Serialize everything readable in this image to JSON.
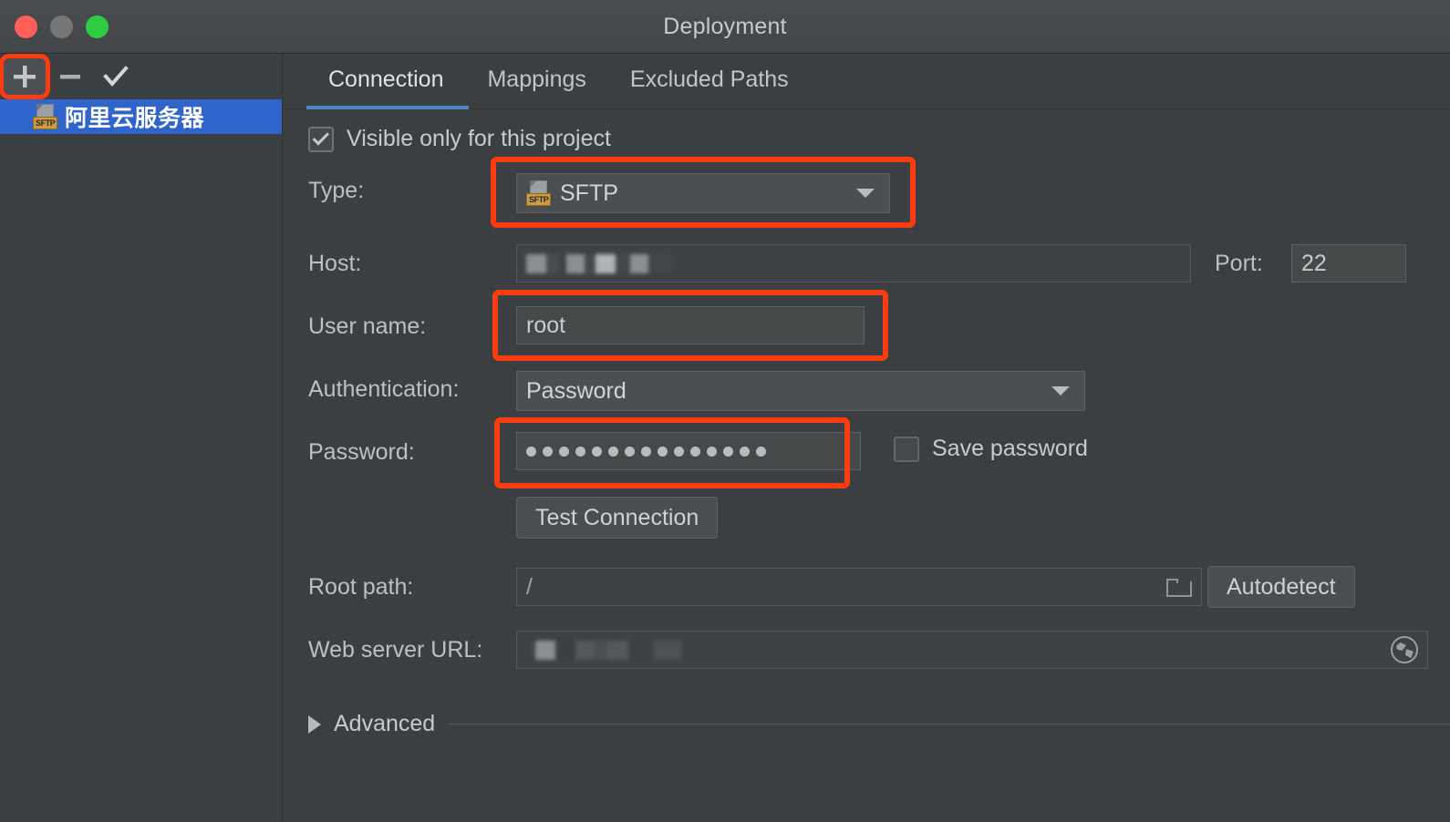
{
  "window": {
    "title": "Deployment",
    "controls": {
      "close": "close-button",
      "minimize": "minimize-button",
      "maximize": "maximize-button"
    }
  },
  "sidebar": {
    "toolbar": [
      {
        "name": "add-server-button",
        "glyph": "+",
        "label": "Add"
      },
      {
        "name": "remove-server-button",
        "glyph": "−",
        "label": "Remove"
      },
      {
        "name": "set-default-button",
        "glyph": "✓",
        "label": "Use as default"
      }
    ],
    "servers": [
      {
        "label": "阿里云服务器",
        "protocol_badge": "SFTP",
        "selected": true
      }
    ]
  },
  "main": {
    "tabs": [
      {
        "label": "Connection",
        "active": true
      },
      {
        "label": "Mappings",
        "active": false
      },
      {
        "label": "Excluded Paths",
        "active": false
      }
    ],
    "visible_only_checkbox": {
      "label": "Visible only for this project",
      "checked": true
    },
    "fields": {
      "type": {
        "label": "Type:",
        "value": "SFTP",
        "badge": "SFTP"
      },
      "host": {
        "label": "Host:",
        "value": "",
        "redacted": true
      },
      "port": {
        "label": "Port:",
        "value": "22"
      },
      "username": {
        "label": "User name:",
        "value": "root"
      },
      "authentication": {
        "label": "Authentication:",
        "value": "Password"
      },
      "password": {
        "label": "Password:",
        "value": "•••••••••••••••",
        "dot_count": 15
      },
      "save_password": {
        "label": "Save password",
        "checked": false
      },
      "root_path": {
        "label": "Root path:",
        "value": "/"
      },
      "web_server_url": {
        "label": "Web server URL:",
        "value": "",
        "redacted": true
      }
    },
    "buttons": {
      "test_connection": "Test Connection",
      "autodetect": "Autodetect"
    },
    "advanced": {
      "label": "Advanced",
      "expanded": false
    }
  },
  "colors": {
    "window_bg": "#3c3f41",
    "titlebar_bg": "#474a4c",
    "selection_blue": "#2f65ca",
    "tab_underline": "#4a86c8",
    "annotation_orange": "#fa3c10",
    "badge_gold": "#cc9b42",
    "text_primary": "#c8cbcd"
  },
  "annotations": [
    {
      "name": "highlight-add-button"
    },
    {
      "name": "highlight-type-combo"
    },
    {
      "name": "highlight-username-field"
    },
    {
      "name": "highlight-password-field"
    }
  ]
}
